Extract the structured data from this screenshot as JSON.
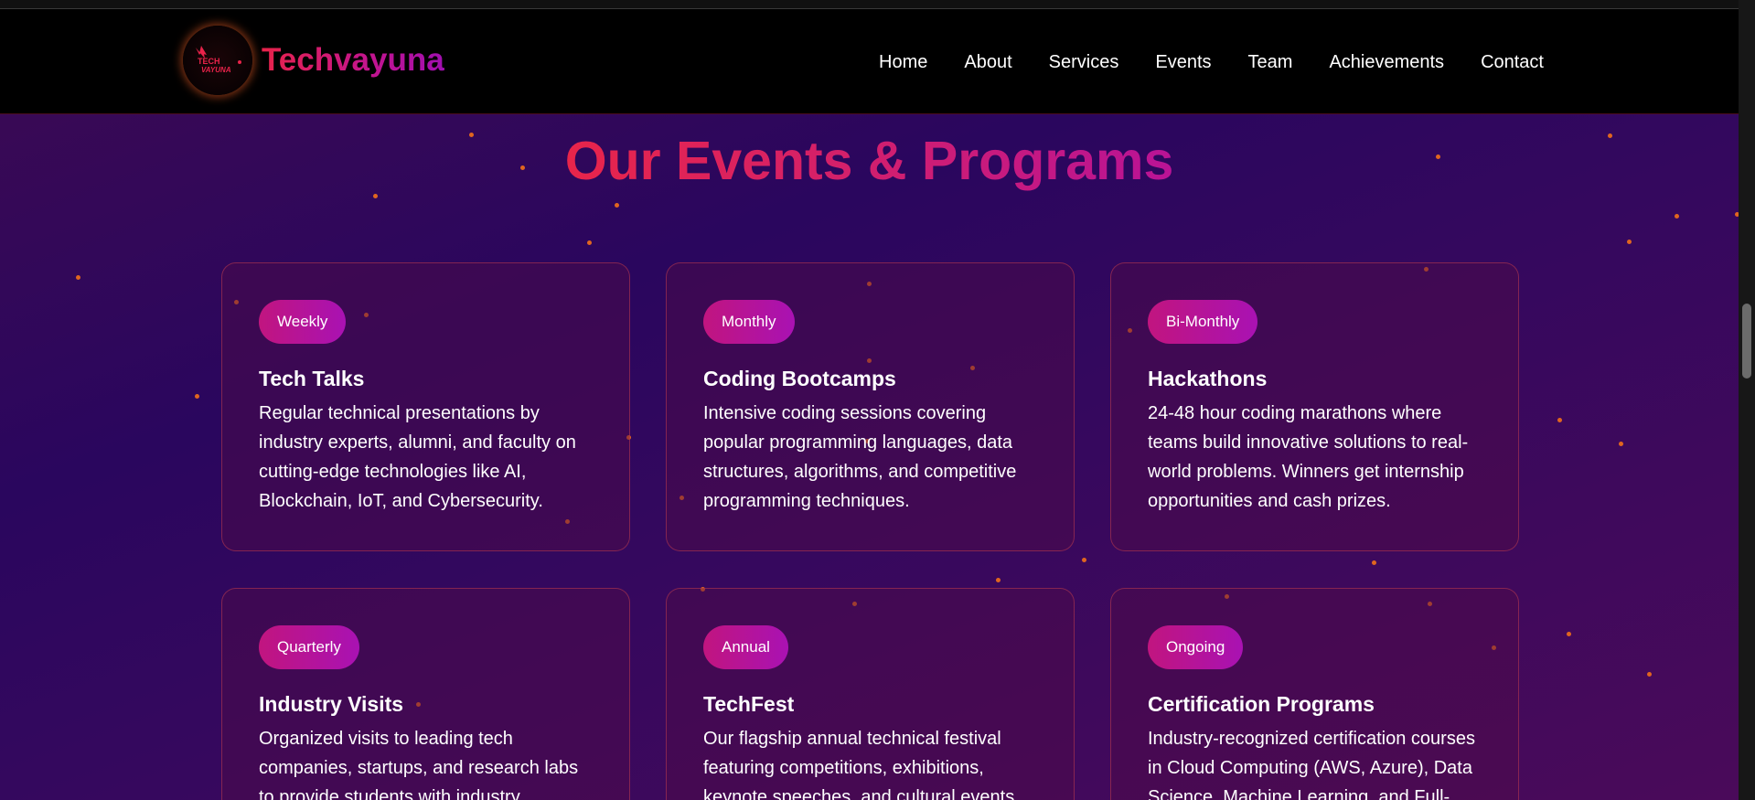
{
  "brand": {
    "name": "Techvayuna",
    "logo_text_top": "TECH",
    "logo_text_bottom": "VAYUNA"
  },
  "nav": {
    "items": [
      "Home",
      "About",
      "Services",
      "Events",
      "Team",
      "Achievements",
      "Contact"
    ]
  },
  "section": {
    "title": "Our Events & Programs"
  },
  "events": [
    {
      "badge": "Weekly",
      "title": "Tech Talks",
      "description": "Regular technical presentations by industry experts, alumni, and faculty on cutting-edge technologies like AI, Blockchain, IoT, and Cybersecurity."
    },
    {
      "badge": "Monthly",
      "title": "Coding Bootcamps",
      "description": "Intensive coding sessions covering popular programming languages, data structures, algorithms, and competitive programming techniques."
    },
    {
      "badge": "Bi-Monthly",
      "title": "Hackathons",
      "description": "24-48 hour coding marathons where teams build innovative solutions to real-world problems. Winners get internship opportunities and cash prizes."
    },
    {
      "badge": "Quarterly",
      "title": "Industry Visits",
      "description": "Organized visits to leading tech companies, startups, and research labs to provide students with industry"
    },
    {
      "badge": "Annual",
      "title": "TechFest",
      "description": "Our flagship annual technical festival featuring competitions, exhibitions, keynote speeches, and cultural events"
    },
    {
      "badge": "Ongoing",
      "title": "Certification Programs",
      "description": "Industry-recognized certification courses in Cloud Computing (AWS, Azure), Data Science, Machine Learning, and Full-"
    }
  ],
  "colors": {
    "accent": "#e8234a",
    "badge": "#b313a0",
    "background": "#2e075c",
    "particle": "#e0661f"
  }
}
